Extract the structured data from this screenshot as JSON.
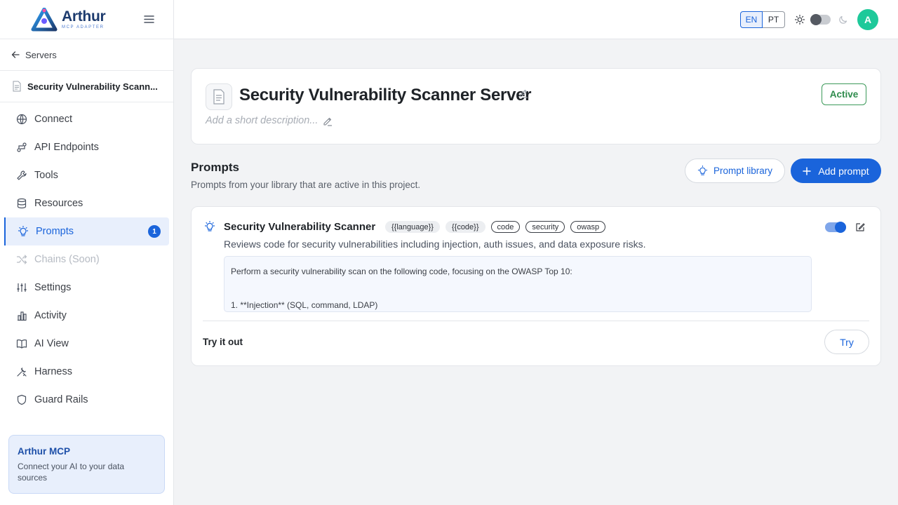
{
  "brand": {
    "name": "Arthur",
    "subtitle": "MCP ADAPTER"
  },
  "sidebar": {
    "back_label": "Servers",
    "server_name": "Security Vulnerability Scann...",
    "items": [
      {
        "label": "Connect",
        "icon": "globe-icon"
      },
      {
        "label": "API Endpoints",
        "icon": "api-icon"
      },
      {
        "label": "Tools",
        "icon": "wrench-icon"
      },
      {
        "label": "Resources",
        "icon": "database-icon"
      },
      {
        "label": "Prompts",
        "icon": "lightbulb-icon",
        "badge": "1",
        "active": true
      },
      {
        "label": "Chains (Soon)",
        "icon": "shuffle-icon",
        "disabled": true
      },
      {
        "label": "Settings",
        "icon": "sliders-icon"
      },
      {
        "label": "Activity",
        "icon": "bar-chart-icon"
      },
      {
        "label": "AI View",
        "icon": "book-icon"
      },
      {
        "label": "Harness",
        "icon": "tools-icon"
      },
      {
        "label": "Guard Rails",
        "icon": "shield-icon"
      }
    ],
    "promo": {
      "title": "Arthur MCP",
      "text": "Connect your AI to your data sources"
    }
  },
  "header": {
    "languages": [
      "EN",
      "PT"
    ],
    "selected_language": "EN",
    "avatar_initial": "A",
    "accent": "#1ec99a"
  },
  "server": {
    "title": "Security Vulnerability Scanner Server",
    "description_placeholder": "Add a short description...",
    "status": "Active"
  },
  "prompts_section": {
    "title": "Prompts",
    "subtitle": "Prompts from your library that are active in this project.",
    "library_button": "Prompt library",
    "add_button": "Add prompt"
  },
  "prompt": {
    "name": "Security Vulnerability Scanner",
    "tags": [
      "{{language}}",
      "{{code}}",
      "code",
      "security",
      "owasp"
    ],
    "description": "Reviews code for security vulnerabilities including injection, auth issues, and data exposure risks.",
    "body_line1": "Perform a security vulnerability scan on the following code, focusing on the OWASP Top 10:",
    "body_line2": "1. **Injection** (SQL, command, LDAP)",
    "enabled": true,
    "try_label": "Try it out",
    "try_button": "Try"
  },
  "colors": {
    "primary": "#1a64db",
    "success": "#2e8b4c"
  }
}
